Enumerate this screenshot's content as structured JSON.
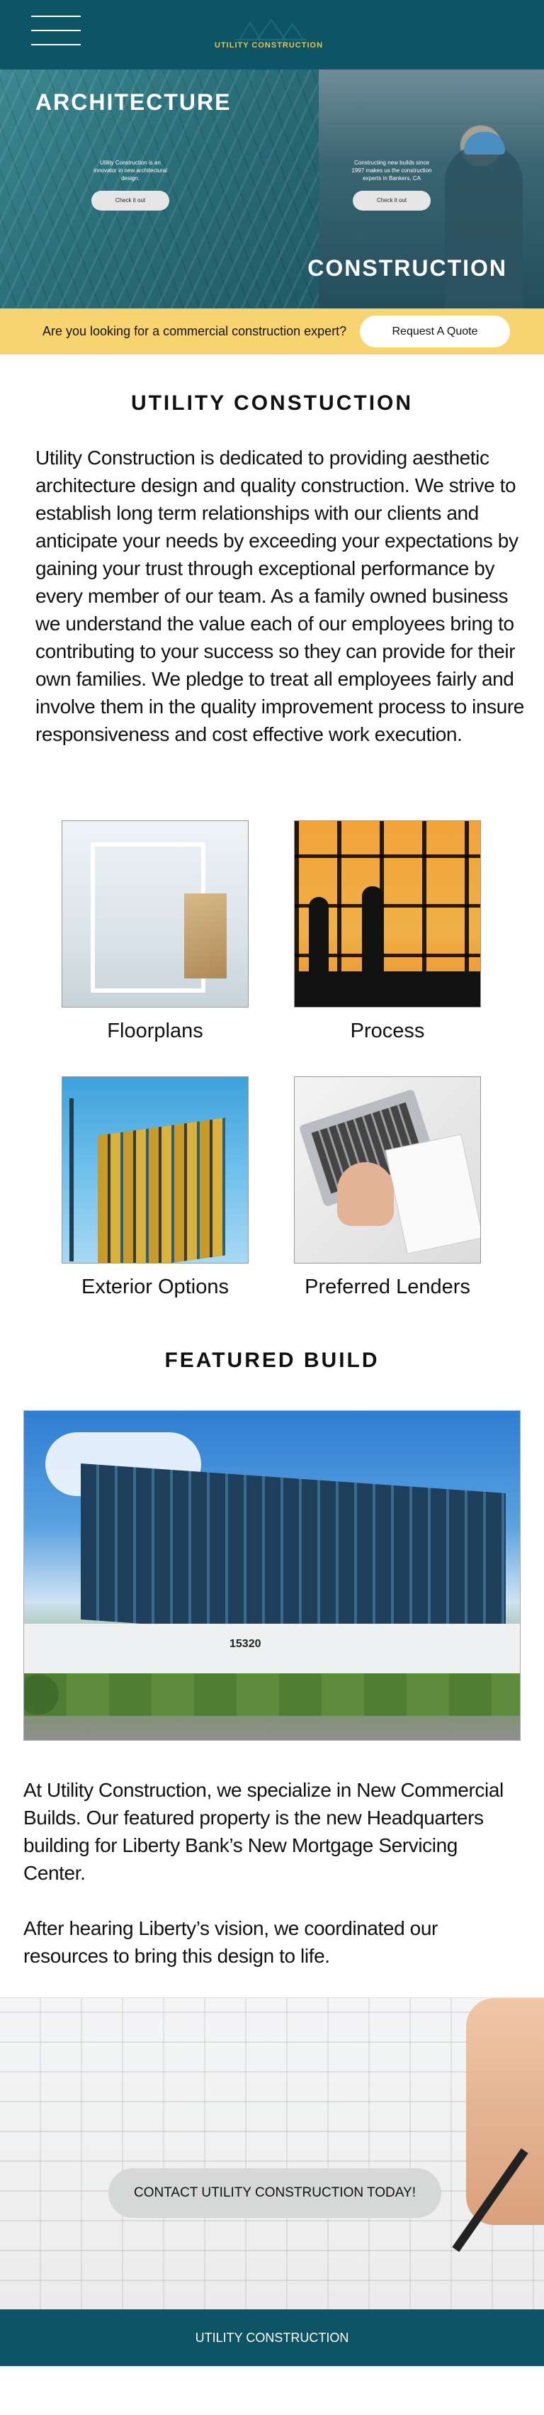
{
  "header": {
    "logo_text": "UTILITY CONSTRUCTION",
    "menu_icon": "hamburger-menu-icon"
  },
  "hero": {
    "left_title": "ARCHITECTURE",
    "right_title": "CONSTRUCTION",
    "left_card": {
      "text": "Utility Construction is an innovator in new architectural design.",
      "button": "Check it out"
    },
    "right_card": {
      "text": "Constructing new builds since 1997 makes us the construction experts in Bankers, CA",
      "button": "Check it out"
    }
  },
  "quote_bar": {
    "text": "Are you looking for a commercial construction expert?",
    "button": "Request A Quote",
    "color": "#f8d471"
  },
  "intro": {
    "title": "UTILITY CONSTUCTION",
    "body": "Utility Construction is dedicated to providing aesthetic architecture design and quality construction. We strive to establish long term relationships with our clients and anticipate your needs by exceeding your expectations by gaining your trust through exceptional performance by every member of our team. As a family owned business we understand the value each of our employees bring to contributing to your success so they can provide for their own families. We pledge to treat all employees fairly and involve them in the quality improvement process to insure responsiveness and cost effective work execution."
  },
  "tiles": [
    {
      "label": "Floorplans"
    },
    {
      "label": "Process"
    },
    {
      "label": "Exterior Options"
    },
    {
      "label": "Preferred Lenders"
    }
  ],
  "featured": {
    "title": "FEATURED BUILD",
    "image_number": "15320",
    "paragraph_1": "At Utility Construction, we specialize in New Commercial Builds. Our featured property is the new Headquarters building for Liberty Bank’s New Mortgage Servicing Center.",
    "paragraph_2": "After hearing Liberty’s vision, we coordinated our resources to bring this design to life."
  },
  "cta": {
    "button": "CONTACT UTILITY CONSTRUCTION TODAY!"
  },
  "footer": {
    "text": "UTILITY CONSTRUCTION",
    "color": "#0d5466"
  }
}
